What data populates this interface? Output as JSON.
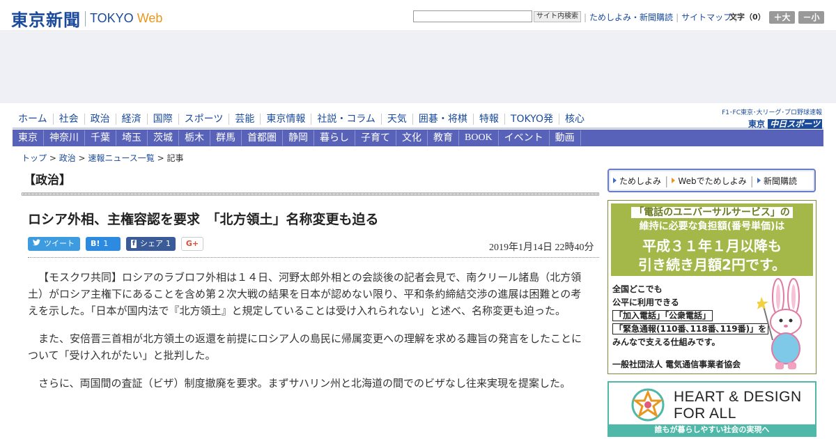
{
  "header": {
    "logo_ja": "東京新聞",
    "logo_en": "TOKYO",
    "logo_web": "Web",
    "search_button": "サイト内検索",
    "links": [
      "ためしよみ・新聞購読",
      "サイトマップ"
    ],
    "font_size_label": "文字（0）",
    "font_larger": "＋大",
    "font_smaller": "－小"
  },
  "main_nav": [
    "ホーム",
    "社会",
    "政治",
    "経済",
    "国際",
    "スポーツ",
    "芸能",
    "東京情報",
    "社説・コラム",
    "天気",
    "囲碁・将棋",
    "特報",
    "TOKYO発",
    "核心"
  ],
  "chunichi": {
    "top": "F1･FC東京･大リーグ･プロ野球速報",
    "prefix": "東京",
    "name": "中日スポーツ"
  },
  "sub_nav": [
    "東京",
    "神奈川",
    "千葉",
    "埼玉",
    "茨城",
    "栃木",
    "群馬",
    "首都圏",
    "静岡",
    "暮らし",
    "子育て",
    "文化",
    "教育",
    "BOOK",
    "イベント",
    "動画"
  ],
  "breadcrumb": {
    "items": [
      "トップ",
      "政治",
      "速報ニュース一覧"
    ],
    "current": "記事",
    "separator": " > "
  },
  "section_title": "【政治】",
  "article": {
    "headline": "ロシア外相、主権容認を要求　「北方領土」名称変更も迫る",
    "date": "2019年1月14日 22時40分",
    "paragraphs": [
      "【モスクワ共同】ロシアのラブロフ外相は１４日、河野太郎外相との会談後の記者会見で、南クリール諸島（北方領土）がロシア主権下にあることを含め第２次大戦の結果を日本が認めない限り、平和条約締結交渉の進展は困難との考えを示した。「日本が国内法で『北方領土』と規定していることは受け入れられない」と述べ、名称変更も迫った。",
      "また、安倍晋三首相が北方領土の返還を前提にロシア人の島民に帰属変更への理解を求める趣旨の発言をしたことについて「受け入れがたい」と批判した。",
      "さらに、両国間の査証（ビザ）制度撤廃を要求。まずサハリン州と北海道の間でのビザなし往来実現を提案した。"
    ]
  },
  "social": {
    "tweet": "ツイート",
    "hatena_icon": "B!",
    "hatena_count": "1",
    "fb_icon": "f",
    "fb_label": "シェア",
    "fb_count": "1",
    "gplus": "G+"
  },
  "sidebar": {
    "links": [
      "ためしよみ",
      "Webでためしよみ",
      "新聞購読"
    ],
    "ad1": {
      "line1": "「電話のユニバーサルサービス」の",
      "line1b": "維持に必要な負担額(番号単価)は",
      "line2": "平成３１年１月以降も",
      "line3": "引き続き月額2円です。",
      "body": [
        "全国どこでも",
        "公平に利用できる",
        "「加入電話」「公衆電話」",
        "「緊急通報(110番､118番､119番)」を",
        "みんなで支える仕組みです。"
      ],
      "footer": "一般社団法人 電気通信事業者協会"
    },
    "ad2": {
      "line1": "HEART & DESIGN",
      "line2": "FOR ALL",
      "footer": "誰もが暮らしやすい社会の実現へ"
    }
  },
  "colors": {
    "brand_blue": "#1a4a9c",
    "web_orange": "#e8961e",
    "subnav_bg": "#5862b8",
    "ad_green": "#a4b84a",
    "heart_teal": "#4fb8a8"
  }
}
